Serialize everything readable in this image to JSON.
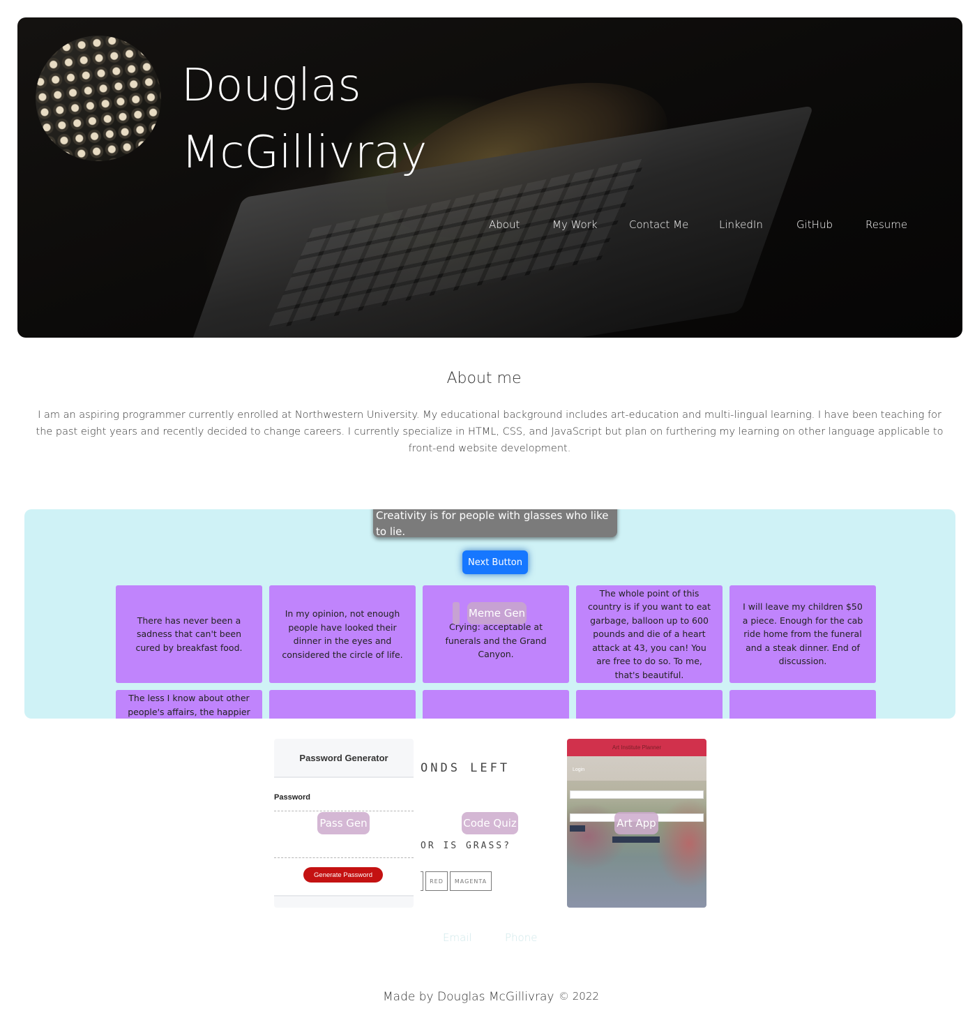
{
  "header": {
    "name_line1": "Douglas",
    "name_line2": "McGillivray",
    "nav": [
      "About",
      "My Work",
      "Contact Me",
      "LinkedIn",
      "GitHub",
      "Resume"
    ]
  },
  "about": {
    "title": "About me",
    "text": "I am an aspiring programmer currently enrolled at Northwestern University. My educational background includes art-education and multi-lingual learning. I have been teaching for the past eight years and recently decided to change careers. I currently specialize in HTML, CSS, and JavaScript but plan on furthering my learning on other language applicable to front-end website development."
  },
  "meme_gen": {
    "quote": "Creativity is for people with glasses who like to lie.",
    "next_button": "Next Button",
    "label": "Meme Gen",
    "cards": [
      "There has never been a sadness that can't been cured by breakfast food.",
      "In my opinion, not enough people have looked their dinner in the eyes and considered the circle of life.",
      "Crying: acceptable at funerals and the Grand Canyon.",
      "The whole point of this country is if you want to eat garbage, balloon up to 600 pounds and die of a heart attack at 43, you can! You are free to do so. To me, that's beautiful.",
      "I will leave my children $50 a piece. Enough for the cab ride home from the funeral and a steak dinner. End of discussion.",
      "The less I know about other people's affairs, the happier I",
      "",
      "",
      "",
      ""
    ]
  },
  "projects": {
    "pass_gen": {
      "label": "Pass Gen",
      "header": "Password Generator",
      "subheader": "Password",
      "button": "Generate Password"
    },
    "code_quiz": {
      "label": "Code Quiz",
      "seconds_text": "ONDS LEFT",
      "question_text": "OR IS GRASS?",
      "options": [
        "",
        "RED",
        "MAGENTA"
      ]
    },
    "art_app": {
      "label": "Art App",
      "title": "Art Institute Planner",
      "login_label": "Login"
    }
  },
  "contact": {
    "email": "Email",
    "phone": "Phone"
  },
  "footer": {
    "made_by": "Made by Douglas McGillivray",
    "copyright": "© 2022"
  }
}
